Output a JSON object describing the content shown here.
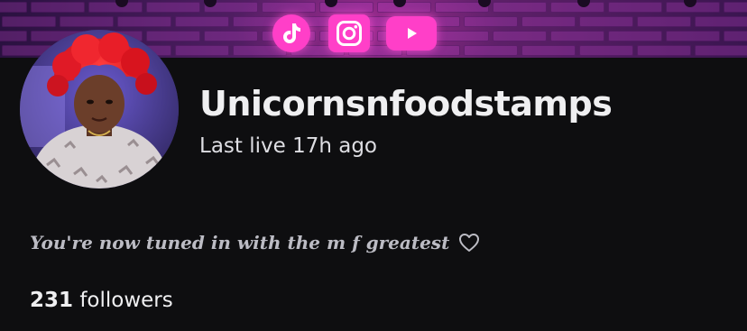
{
  "profile": {
    "username": "Unicornsnfoodstamps",
    "last_live": "Last live 17h ago",
    "bio": "You're now tuned in with the m f greatest",
    "followers_count": "231",
    "followers_label": "followers"
  },
  "social_links": [
    {
      "icon": "tiktok-icon"
    },
    {
      "icon": "instagram-icon"
    },
    {
      "icon": "youtube-icon"
    }
  ],
  "colors": {
    "background": "#0e0e10",
    "banner_purple": "#4a1c5e",
    "icon_pink": "#ff3fc8",
    "username_text": "#efeff1",
    "secondary_text": "#dedee3",
    "bio_text": "#bcbcc4"
  }
}
